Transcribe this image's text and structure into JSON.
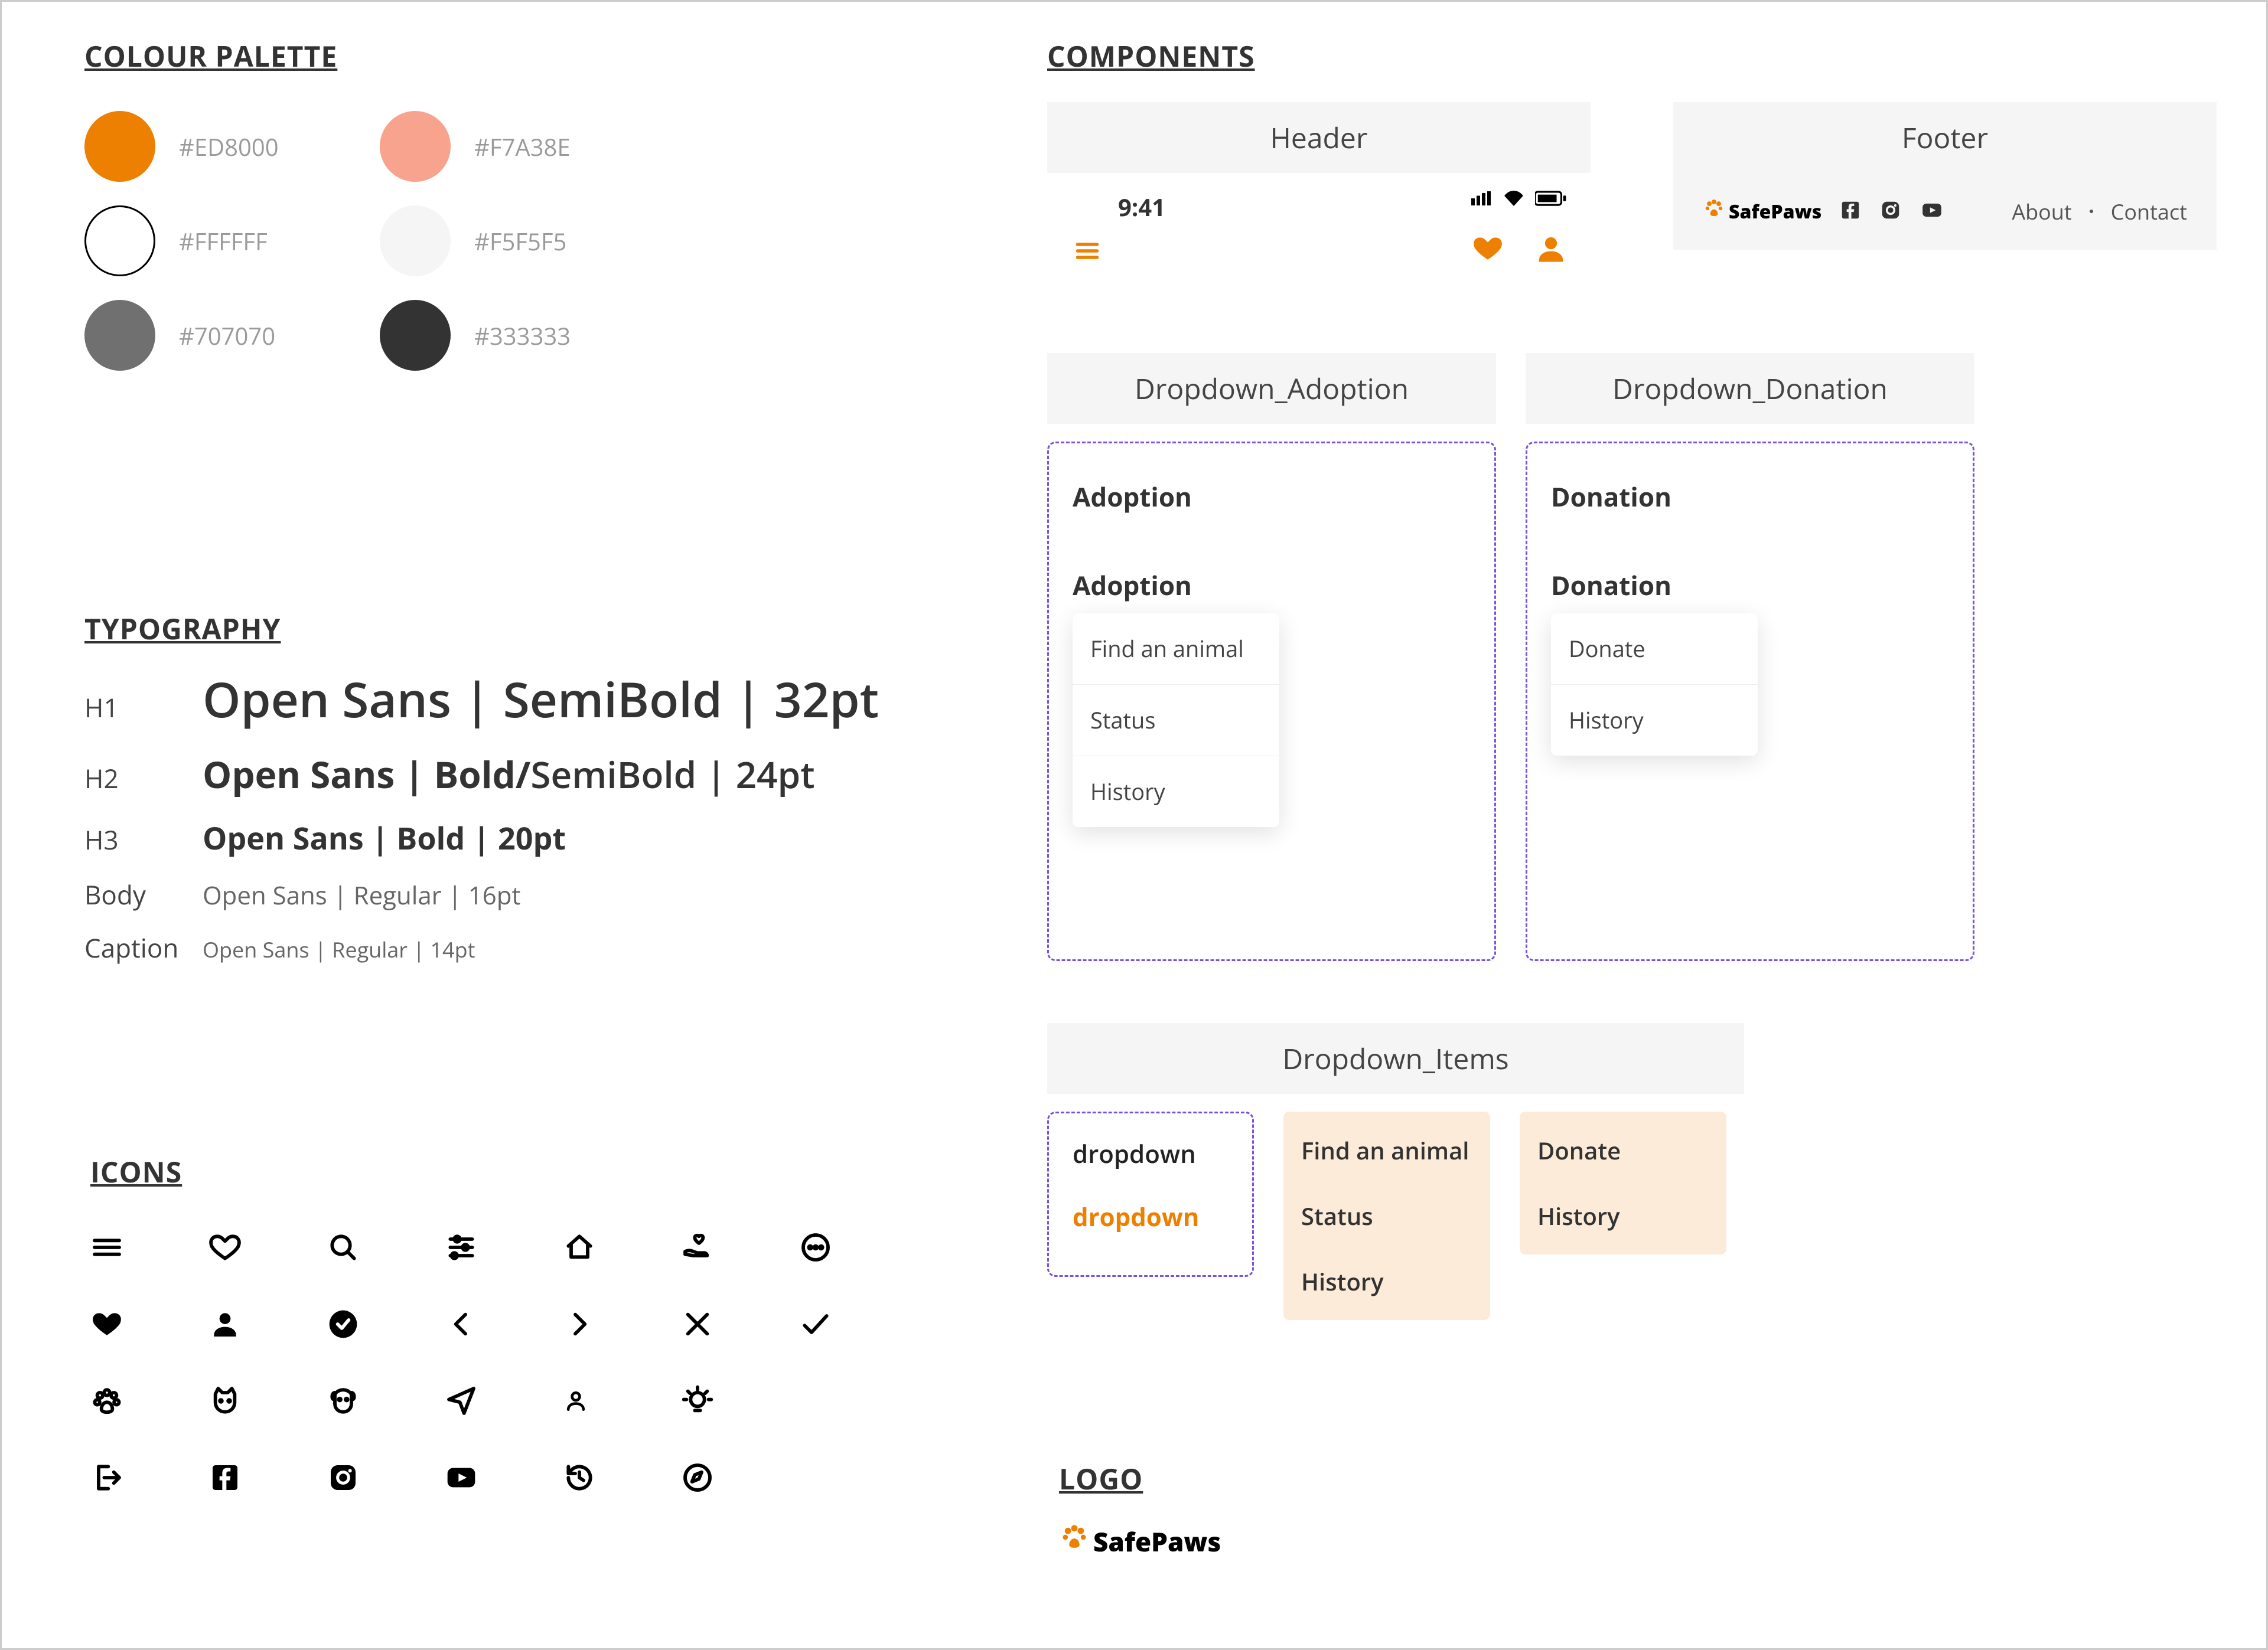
{
  "sections": {
    "palette": "COLOUR PALETTE",
    "typography": "TYPOGRAPHY",
    "icons": "ICONS",
    "components": "COMPONENTS",
    "logo": "LOGO"
  },
  "palette": [
    {
      "hex": "#ED8000"
    },
    {
      "hex": "#F7A38E"
    },
    {
      "hex": "#FFFFFF"
    },
    {
      "hex": "#F5F5F5"
    },
    {
      "hex": "#707070"
    },
    {
      "hex": "#333333"
    }
  ],
  "typography": {
    "h1": {
      "tag": "H1",
      "spec": "Open Sans | SemiBold | 32pt"
    },
    "h2": {
      "tag": "H2",
      "spec_bold": "Open Sans | Bold/",
      "spec_rest": "SemiBold | 24pt"
    },
    "h3": {
      "tag": "H3",
      "spec": "Open Sans | Bold | 20pt"
    },
    "body": {
      "tag": "Body",
      "spec": "Open Sans | Regular | 16pt"
    },
    "caption": {
      "tag": "Caption",
      "spec": "Open Sans | Regular | 14pt"
    }
  },
  "components": {
    "header": {
      "label": "Header",
      "time": "9:41"
    },
    "footer": {
      "label": "Footer",
      "brand": "SafePaws",
      "links": [
        "About",
        "Contact"
      ]
    },
    "dd_adoption": {
      "label": "Dropdown_Adoption",
      "closed": "Adoption",
      "open": "Adoption",
      "items": [
        "Find an animal",
        "Status",
        "History"
      ]
    },
    "dd_donation": {
      "label": "Dropdown_Donation",
      "closed": "Donation",
      "open": "Donation",
      "items": [
        "Donate",
        "History"
      ]
    },
    "dd_items": {
      "label": "Dropdown_Items",
      "default_top": "dropdown",
      "default_bottom": "dropdown",
      "adoption": [
        "Find an animal",
        "Status",
        "History"
      ],
      "donation": [
        "Donate",
        "History"
      ]
    }
  },
  "logo": {
    "brand": "SafePaws"
  }
}
